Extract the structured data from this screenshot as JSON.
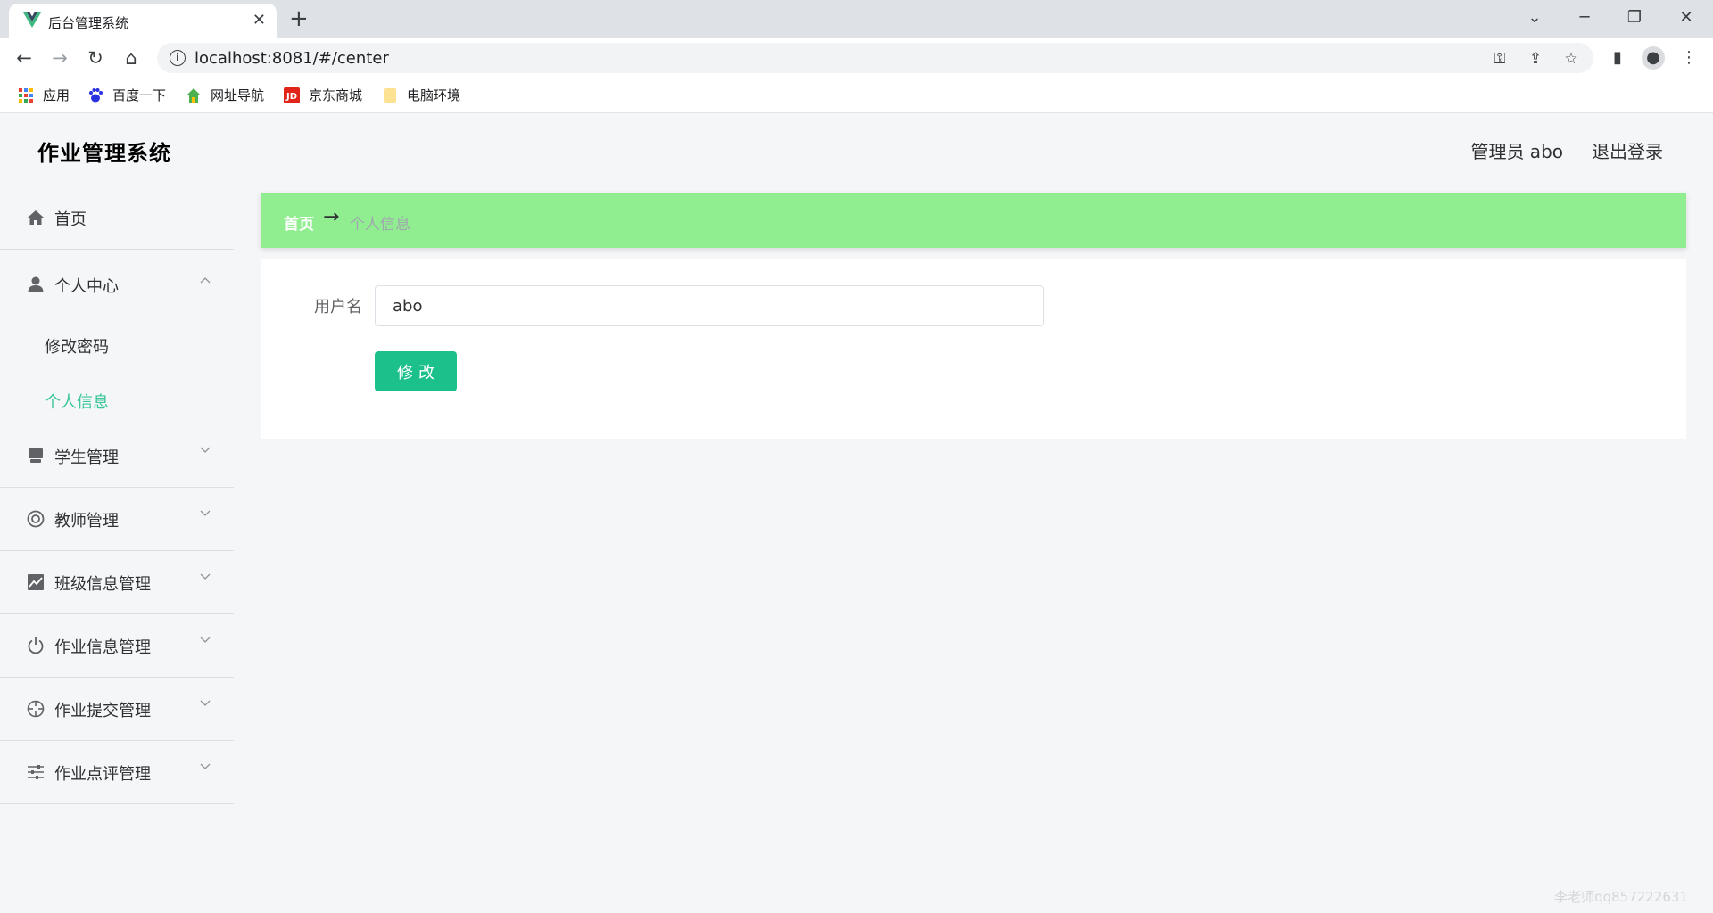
{
  "browser": {
    "tab_title": "后台管理系统",
    "url": "localhost:8081/#/center",
    "bookmarks": [
      {
        "label": "应用",
        "icon": "apps-grid-icon"
      },
      {
        "label": "百度一下",
        "icon": "baidu-paw-icon"
      },
      {
        "label": "网址导航",
        "icon": "hao123-icon"
      },
      {
        "label": "京东商城",
        "icon": "jd-icon"
      },
      {
        "label": "电脑环境",
        "icon": "folder-icon"
      }
    ]
  },
  "header": {
    "brand": "作业管理系统",
    "user_label": "管理员 abo",
    "logout": "退出登录"
  },
  "sidebar": {
    "items": [
      {
        "label": "首页",
        "icon": "home-icon"
      },
      {
        "label": "个人中心",
        "icon": "user-icon",
        "expanded": true,
        "children": [
          {
            "label": "修改密码"
          },
          {
            "label": "个人信息",
            "active": true
          }
        ]
      },
      {
        "label": "学生管理",
        "icon": "monitor-icon"
      },
      {
        "label": "教师管理",
        "icon": "lifebuoy-icon"
      },
      {
        "label": "班级信息管理",
        "icon": "chart-icon"
      },
      {
        "label": "作业信息管理",
        "icon": "power-icon"
      },
      {
        "label": "作业提交管理",
        "icon": "target-icon"
      },
      {
        "label": "作业点评管理",
        "icon": "sliders-icon"
      }
    ]
  },
  "breadcrumb": {
    "home": "首页",
    "separator": "→",
    "current": "个人信息"
  },
  "form": {
    "username_label": "用户名",
    "username_value": "abo",
    "submit_label": "修改"
  },
  "colors": {
    "accent": "#3bc59a",
    "button": "#1cc08a",
    "breadcrumb_bg": "#90ee90"
  },
  "watermark": "李老师qq857222631"
}
